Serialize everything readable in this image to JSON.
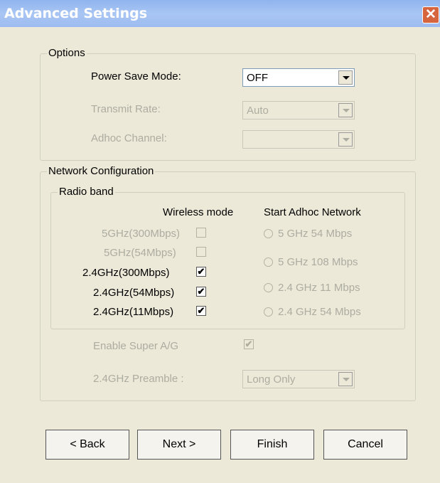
{
  "window": {
    "title": "Advanced Settings",
    "close_label": "✕"
  },
  "options": {
    "legend": "Options",
    "power_save_label": "Power Save Mode:",
    "power_save_value": "OFF",
    "transmit_rate_label": "Transmit Rate:",
    "transmit_rate_value": "Auto",
    "adhoc_channel_label": "Adhoc Channel:",
    "adhoc_channel_value": ""
  },
  "network": {
    "legend": "Network Configuration",
    "radio_band": {
      "legend": "Radio band",
      "wireless_mode_header": "Wireless mode",
      "start_adhoc_header": "Start Adhoc Network",
      "modes": [
        {
          "label": "5GHz(300Mbps)",
          "checked": false,
          "enabled": false
        },
        {
          "label": "5GHz(54Mbps)",
          "checked": false,
          "enabled": false
        },
        {
          "label": "2.4GHz(300Mbps)",
          "checked": true,
          "enabled": true
        },
        {
          "label": "2.4GHz(54Mbps)",
          "checked": true,
          "enabled": true
        },
        {
          "label": "2.4GHz(11Mbps)",
          "checked": true,
          "enabled": true
        }
      ],
      "adhoc": [
        {
          "label": "5 GHz 54 Mbps"
        },
        {
          "label": "5 GHz 108 Mbps"
        },
        {
          "label": "2.4 GHz 11 Mbps"
        },
        {
          "label": "2.4 GHz 54 Mbps"
        }
      ]
    },
    "super_ag_label": "Enable Super A/G",
    "super_ag_checked": true,
    "preamble_label": "2.4GHz Preamble :",
    "preamble_value": "Long Only"
  },
  "buttons": {
    "back": "< Back",
    "next": "Next >",
    "finish": "Finish",
    "cancel": "Cancel"
  },
  "check_mark": "✔"
}
